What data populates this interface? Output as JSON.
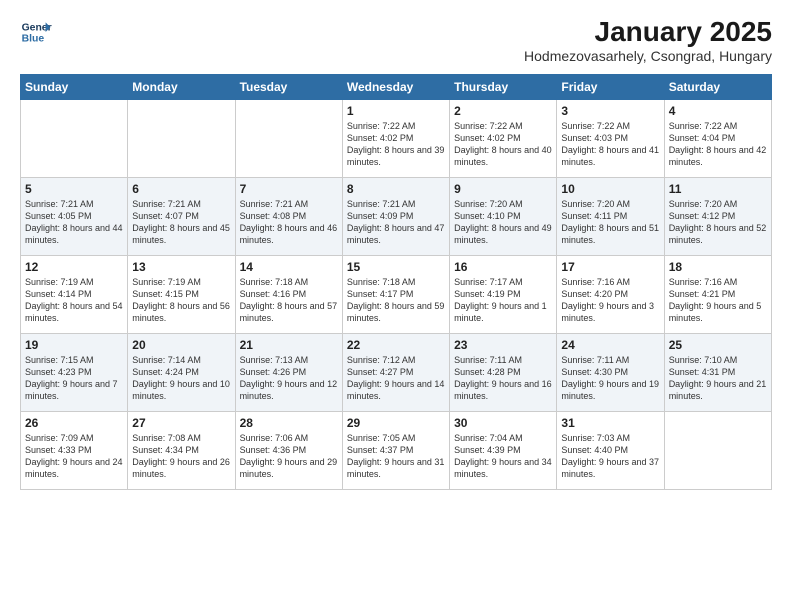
{
  "header": {
    "logo_line1": "General",
    "logo_line2": "Blue",
    "title": "January 2025",
    "subtitle": "Hodmezovasarhely, Csongrad, Hungary"
  },
  "days_of_week": [
    "Sunday",
    "Monday",
    "Tuesday",
    "Wednesday",
    "Thursday",
    "Friday",
    "Saturday"
  ],
  "weeks": [
    [
      {
        "day": "",
        "content": ""
      },
      {
        "day": "",
        "content": ""
      },
      {
        "day": "",
        "content": ""
      },
      {
        "day": "1",
        "content": "Sunrise: 7:22 AM\nSunset: 4:02 PM\nDaylight: 8 hours and 39 minutes."
      },
      {
        "day": "2",
        "content": "Sunrise: 7:22 AM\nSunset: 4:02 PM\nDaylight: 8 hours and 40 minutes."
      },
      {
        "day": "3",
        "content": "Sunrise: 7:22 AM\nSunset: 4:03 PM\nDaylight: 8 hours and 41 minutes."
      },
      {
        "day": "4",
        "content": "Sunrise: 7:22 AM\nSunset: 4:04 PM\nDaylight: 8 hours and 42 minutes."
      }
    ],
    [
      {
        "day": "5",
        "content": "Sunrise: 7:21 AM\nSunset: 4:05 PM\nDaylight: 8 hours and 44 minutes."
      },
      {
        "day": "6",
        "content": "Sunrise: 7:21 AM\nSunset: 4:07 PM\nDaylight: 8 hours and 45 minutes."
      },
      {
        "day": "7",
        "content": "Sunrise: 7:21 AM\nSunset: 4:08 PM\nDaylight: 8 hours and 46 minutes."
      },
      {
        "day": "8",
        "content": "Sunrise: 7:21 AM\nSunset: 4:09 PM\nDaylight: 8 hours and 47 minutes."
      },
      {
        "day": "9",
        "content": "Sunrise: 7:20 AM\nSunset: 4:10 PM\nDaylight: 8 hours and 49 minutes."
      },
      {
        "day": "10",
        "content": "Sunrise: 7:20 AM\nSunset: 4:11 PM\nDaylight: 8 hours and 51 minutes."
      },
      {
        "day": "11",
        "content": "Sunrise: 7:20 AM\nSunset: 4:12 PM\nDaylight: 8 hours and 52 minutes."
      }
    ],
    [
      {
        "day": "12",
        "content": "Sunrise: 7:19 AM\nSunset: 4:14 PM\nDaylight: 8 hours and 54 minutes."
      },
      {
        "day": "13",
        "content": "Sunrise: 7:19 AM\nSunset: 4:15 PM\nDaylight: 8 hours and 56 minutes."
      },
      {
        "day": "14",
        "content": "Sunrise: 7:18 AM\nSunset: 4:16 PM\nDaylight: 8 hours and 57 minutes."
      },
      {
        "day": "15",
        "content": "Sunrise: 7:18 AM\nSunset: 4:17 PM\nDaylight: 8 hours and 59 minutes."
      },
      {
        "day": "16",
        "content": "Sunrise: 7:17 AM\nSunset: 4:19 PM\nDaylight: 9 hours and 1 minute."
      },
      {
        "day": "17",
        "content": "Sunrise: 7:16 AM\nSunset: 4:20 PM\nDaylight: 9 hours and 3 minutes."
      },
      {
        "day": "18",
        "content": "Sunrise: 7:16 AM\nSunset: 4:21 PM\nDaylight: 9 hours and 5 minutes."
      }
    ],
    [
      {
        "day": "19",
        "content": "Sunrise: 7:15 AM\nSunset: 4:23 PM\nDaylight: 9 hours and 7 minutes."
      },
      {
        "day": "20",
        "content": "Sunrise: 7:14 AM\nSunset: 4:24 PM\nDaylight: 9 hours and 10 minutes."
      },
      {
        "day": "21",
        "content": "Sunrise: 7:13 AM\nSunset: 4:26 PM\nDaylight: 9 hours and 12 minutes."
      },
      {
        "day": "22",
        "content": "Sunrise: 7:12 AM\nSunset: 4:27 PM\nDaylight: 9 hours and 14 minutes."
      },
      {
        "day": "23",
        "content": "Sunrise: 7:11 AM\nSunset: 4:28 PM\nDaylight: 9 hours and 16 minutes."
      },
      {
        "day": "24",
        "content": "Sunrise: 7:11 AM\nSunset: 4:30 PM\nDaylight: 9 hours and 19 minutes."
      },
      {
        "day": "25",
        "content": "Sunrise: 7:10 AM\nSunset: 4:31 PM\nDaylight: 9 hours and 21 minutes."
      }
    ],
    [
      {
        "day": "26",
        "content": "Sunrise: 7:09 AM\nSunset: 4:33 PM\nDaylight: 9 hours and 24 minutes."
      },
      {
        "day": "27",
        "content": "Sunrise: 7:08 AM\nSunset: 4:34 PM\nDaylight: 9 hours and 26 minutes."
      },
      {
        "day": "28",
        "content": "Sunrise: 7:06 AM\nSunset: 4:36 PM\nDaylight: 9 hours and 29 minutes."
      },
      {
        "day": "29",
        "content": "Sunrise: 7:05 AM\nSunset: 4:37 PM\nDaylight: 9 hours and 31 minutes."
      },
      {
        "day": "30",
        "content": "Sunrise: 7:04 AM\nSunset: 4:39 PM\nDaylight: 9 hours and 34 minutes."
      },
      {
        "day": "31",
        "content": "Sunrise: 7:03 AM\nSunset: 4:40 PM\nDaylight: 9 hours and 37 minutes."
      },
      {
        "day": "",
        "content": ""
      }
    ]
  ]
}
